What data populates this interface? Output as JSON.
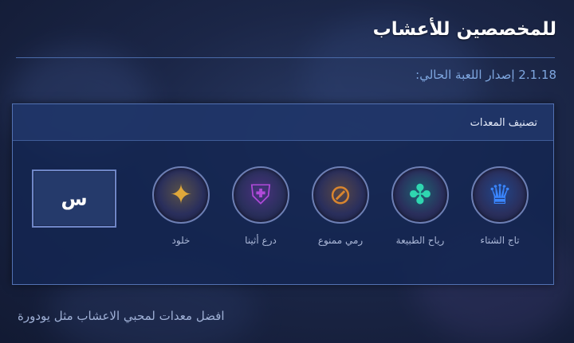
{
  "header": {
    "title": "للمخصصين للأعشاب",
    "version": "2.1.18 إصدار اللعبة الحالي:"
  },
  "panel": {
    "title": "تصنيف المعدات",
    "items": [
      {
        "label": "تاج الشتاء",
        "icon": "winter-crown-icon",
        "color": "#3a86ff",
        "glyph": "♛"
      },
      {
        "label": "رياح الطبيعة",
        "icon": "wind-of-nature-icon",
        "color": "#2fd6b0",
        "glyph": "✤"
      },
      {
        "label": "رمي ممنوع",
        "icon": "forbidden-throw-icon",
        "color": "#d9852f",
        "glyph": "⊘"
      },
      {
        "label": "درع أثينا",
        "icon": "athenas-shield-icon",
        "color": "#b04ad9",
        "glyph": "⛨"
      },
      {
        "label": "خلود",
        "icon": "immortality-icon",
        "color": "#e0a83a",
        "glyph": "✦"
      }
    ],
    "slot_label": "س"
  },
  "footer": {
    "text": "افضل معدات لمحبي الاعشاب مثل يودورة"
  }
}
